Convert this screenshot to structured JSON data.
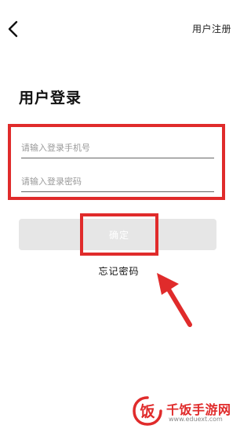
{
  "header": {
    "back_icon": "chevron-left-icon",
    "register_label": "用户注册"
  },
  "main": {
    "title": "用户登录",
    "phone_placeholder": "请输入登录手机号",
    "phone_value": "",
    "password_placeholder": "请输入登录密码",
    "password_value": "",
    "confirm_label": "确定",
    "forgot_label": "忘记密码"
  },
  "annotations": {
    "highlight_color": "#e02b2b",
    "arrow_icon": "arrow-up-left-icon"
  },
  "watermark": {
    "logo_char": "饭",
    "name": "千饭手游网",
    "url": "www.eduext.com"
  },
  "colors": {
    "accent": "#e02b2b",
    "button_disabled_bg": "#e6e6e6",
    "placeholder": "#9a9a9a"
  }
}
